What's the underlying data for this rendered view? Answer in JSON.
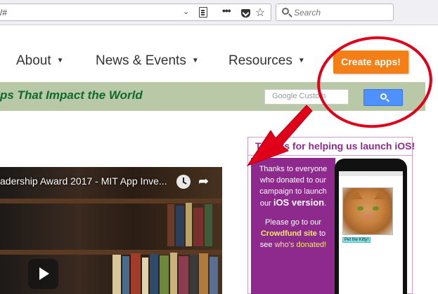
{
  "browser": {
    "url": "/#",
    "search_placeholder": "Search"
  },
  "nav": {
    "items": [
      {
        "label": "About"
      },
      {
        "label": "News & Events"
      },
      {
        "label": "Resources"
      }
    ],
    "create_apps_label": "Create apps!"
  },
  "banner": {
    "tagline": "ps That Impact the World",
    "search_placeholder": "Google Custom"
  },
  "video": {
    "title": "adership Award 2017 - MIT App Inve..."
  },
  "promo": {
    "title": "Thanks for helping us launch iOS!",
    "line1": "Thanks to everyone who donated to our campaign to launch our",
    "ios_version": "iOS version",
    "line2_prefix": "Please go to our",
    "crowdfund_link": "Crowdfund site",
    "line2_mid": "to see",
    "donated_link": "who's donated!",
    "phone_button": "Pet the Kitty!"
  },
  "colors": {
    "accent_orange": "#f57f17",
    "banner_green": "#b9c9a8",
    "tagline_green": "#0e6b2e",
    "promo_purple": "#8e2a8e",
    "annotation_red": "#e0001a"
  }
}
